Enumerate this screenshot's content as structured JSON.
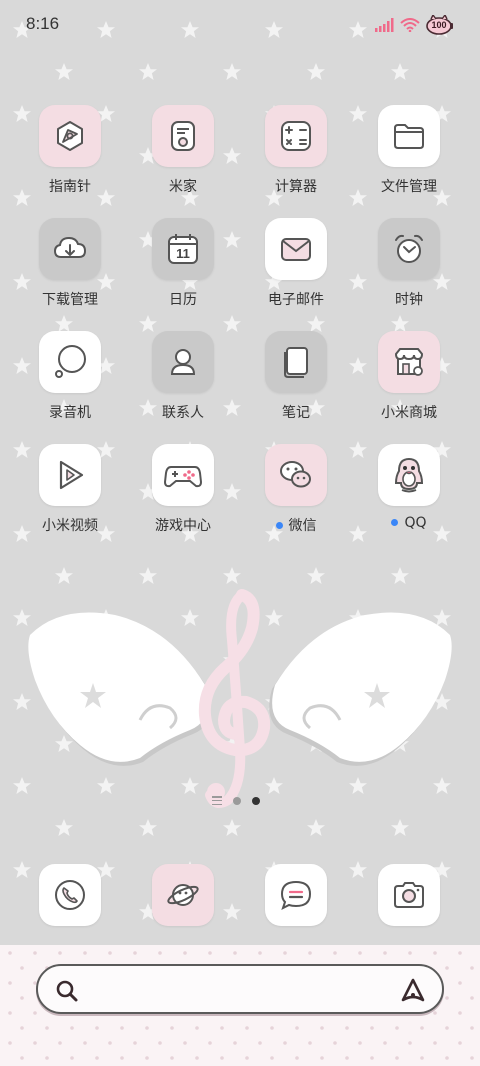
{
  "status": {
    "time": "8:16",
    "battery": "100",
    "icons": [
      "signal-icon",
      "wifi-icon",
      "battery-icon"
    ]
  },
  "apps": [
    {
      "label": "指南针",
      "icon": "compass-icon",
      "style": "pink"
    },
    {
      "label": "米家",
      "icon": "mi-home-icon",
      "style": "pink"
    },
    {
      "label": "计算器",
      "icon": "calculator-icon",
      "style": "pink"
    },
    {
      "label": "文件管理",
      "icon": "folder-icon",
      "style": "white"
    },
    {
      "label": "下载管理",
      "icon": "download-cloud-icon",
      "style": "gray"
    },
    {
      "label": "日历",
      "icon": "calendar-icon",
      "style": "gray",
      "calendar_day": "11"
    },
    {
      "label": "电子邮件",
      "icon": "mail-icon",
      "style": "white"
    },
    {
      "label": "时钟",
      "icon": "alarm-clock-icon",
      "style": "gray"
    },
    {
      "label": "录音机",
      "icon": "recorder-icon",
      "style": "white"
    },
    {
      "label": "联系人",
      "icon": "contacts-icon",
      "style": "gray"
    },
    {
      "label": "笔记",
      "icon": "notes-icon",
      "style": "gray"
    },
    {
      "label": "小米商城",
      "icon": "store-icon",
      "style": "pink"
    },
    {
      "label": "小米视频",
      "icon": "video-play-icon",
      "style": "white"
    },
    {
      "label": "游戏中心",
      "icon": "gamepad-icon",
      "style": "white"
    },
    {
      "label": "微信",
      "icon": "wechat-icon",
      "style": "pink",
      "notification_dot": true
    },
    {
      "label": "QQ",
      "icon": "qq-penguin-icon",
      "style": "white",
      "notification_dot": true
    }
  ],
  "dock": [
    {
      "icon": "phone-icon",
      "style": "white"
    },
    {
      "icon": "browser-planet-icon",
      "style": "pink"
    },
    {
      "icon": "messages-icon",
      "style": "white"
    },
    {
      "icon": "camera-icon",
      "style": "white"
    }
  ],
  "page_indicator": {
    "pages": 3,
    "current": 2
  },
  "colors": {
    "background": "#d9d9d9",
    "pink_tile": "#f4dde3",
    "white_tile": "#ffffff",
    "gray_tile": "#c9c9c9",
    "accent_pink": "#f06a8a",
    "notification_dot": "#3a86f7",
    "icon_stroke": "#555555"
  },
  "search": {
    "left_icon": "search-icon",
    "right_icon": "assistant-icon"
  }
}
